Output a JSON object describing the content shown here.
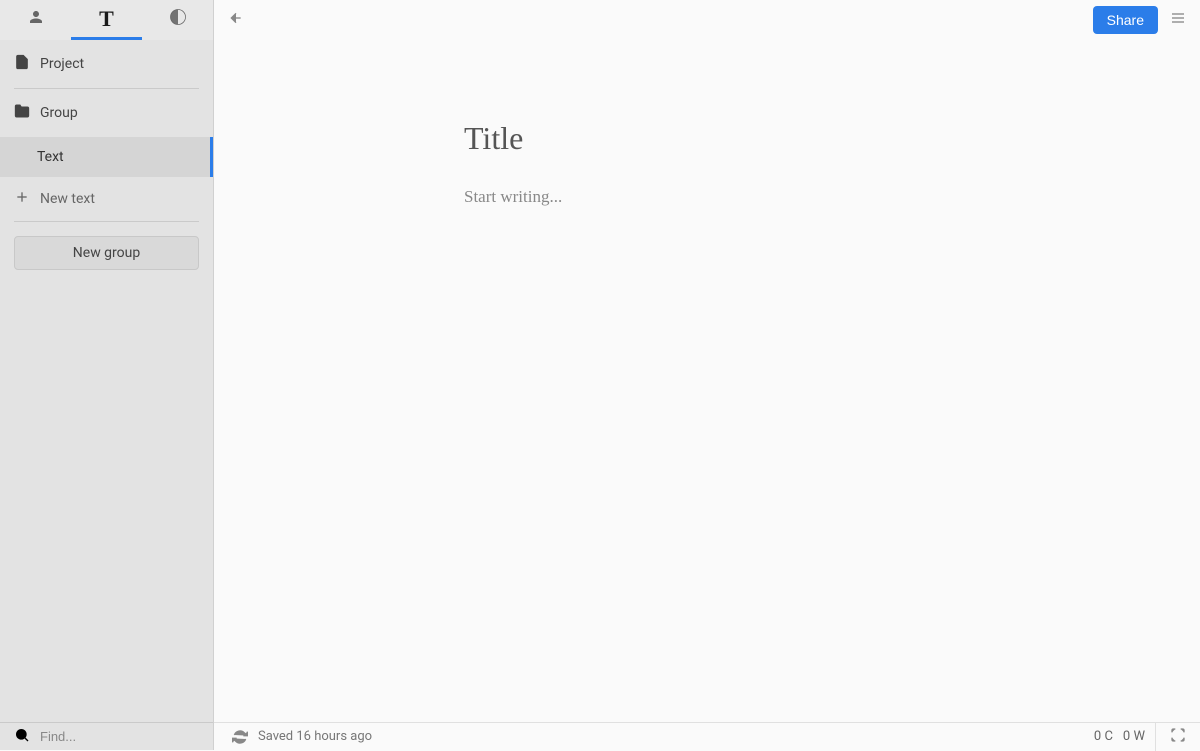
{
  "sidebar": {
    "project_label": "Project",
    "group_label": "Group",
    "text_label": "Text",
    "new_text_label": "New text",
    "new_group_label": "New group",
    "search_placeholder": "Find..."
  },
  "topbar": {
    "share_label": "Share"
  },
  "editor": {
    "title_placeholder": "Title",
    "title_value": "",
    "body_placeholder": "Start writing...",
    "body_value": ""
  },
  "statusbar": {
    "saved_label": "Saved 16 hours ago",
    "char_count": "0 C",
    "word_count": "0 W"
  },
  "colors": {
    "accent": "#2b7de9",
    "sidebar_bg": "#e3e3e3",
    "main_bg": "#fafafa"
  }
}
